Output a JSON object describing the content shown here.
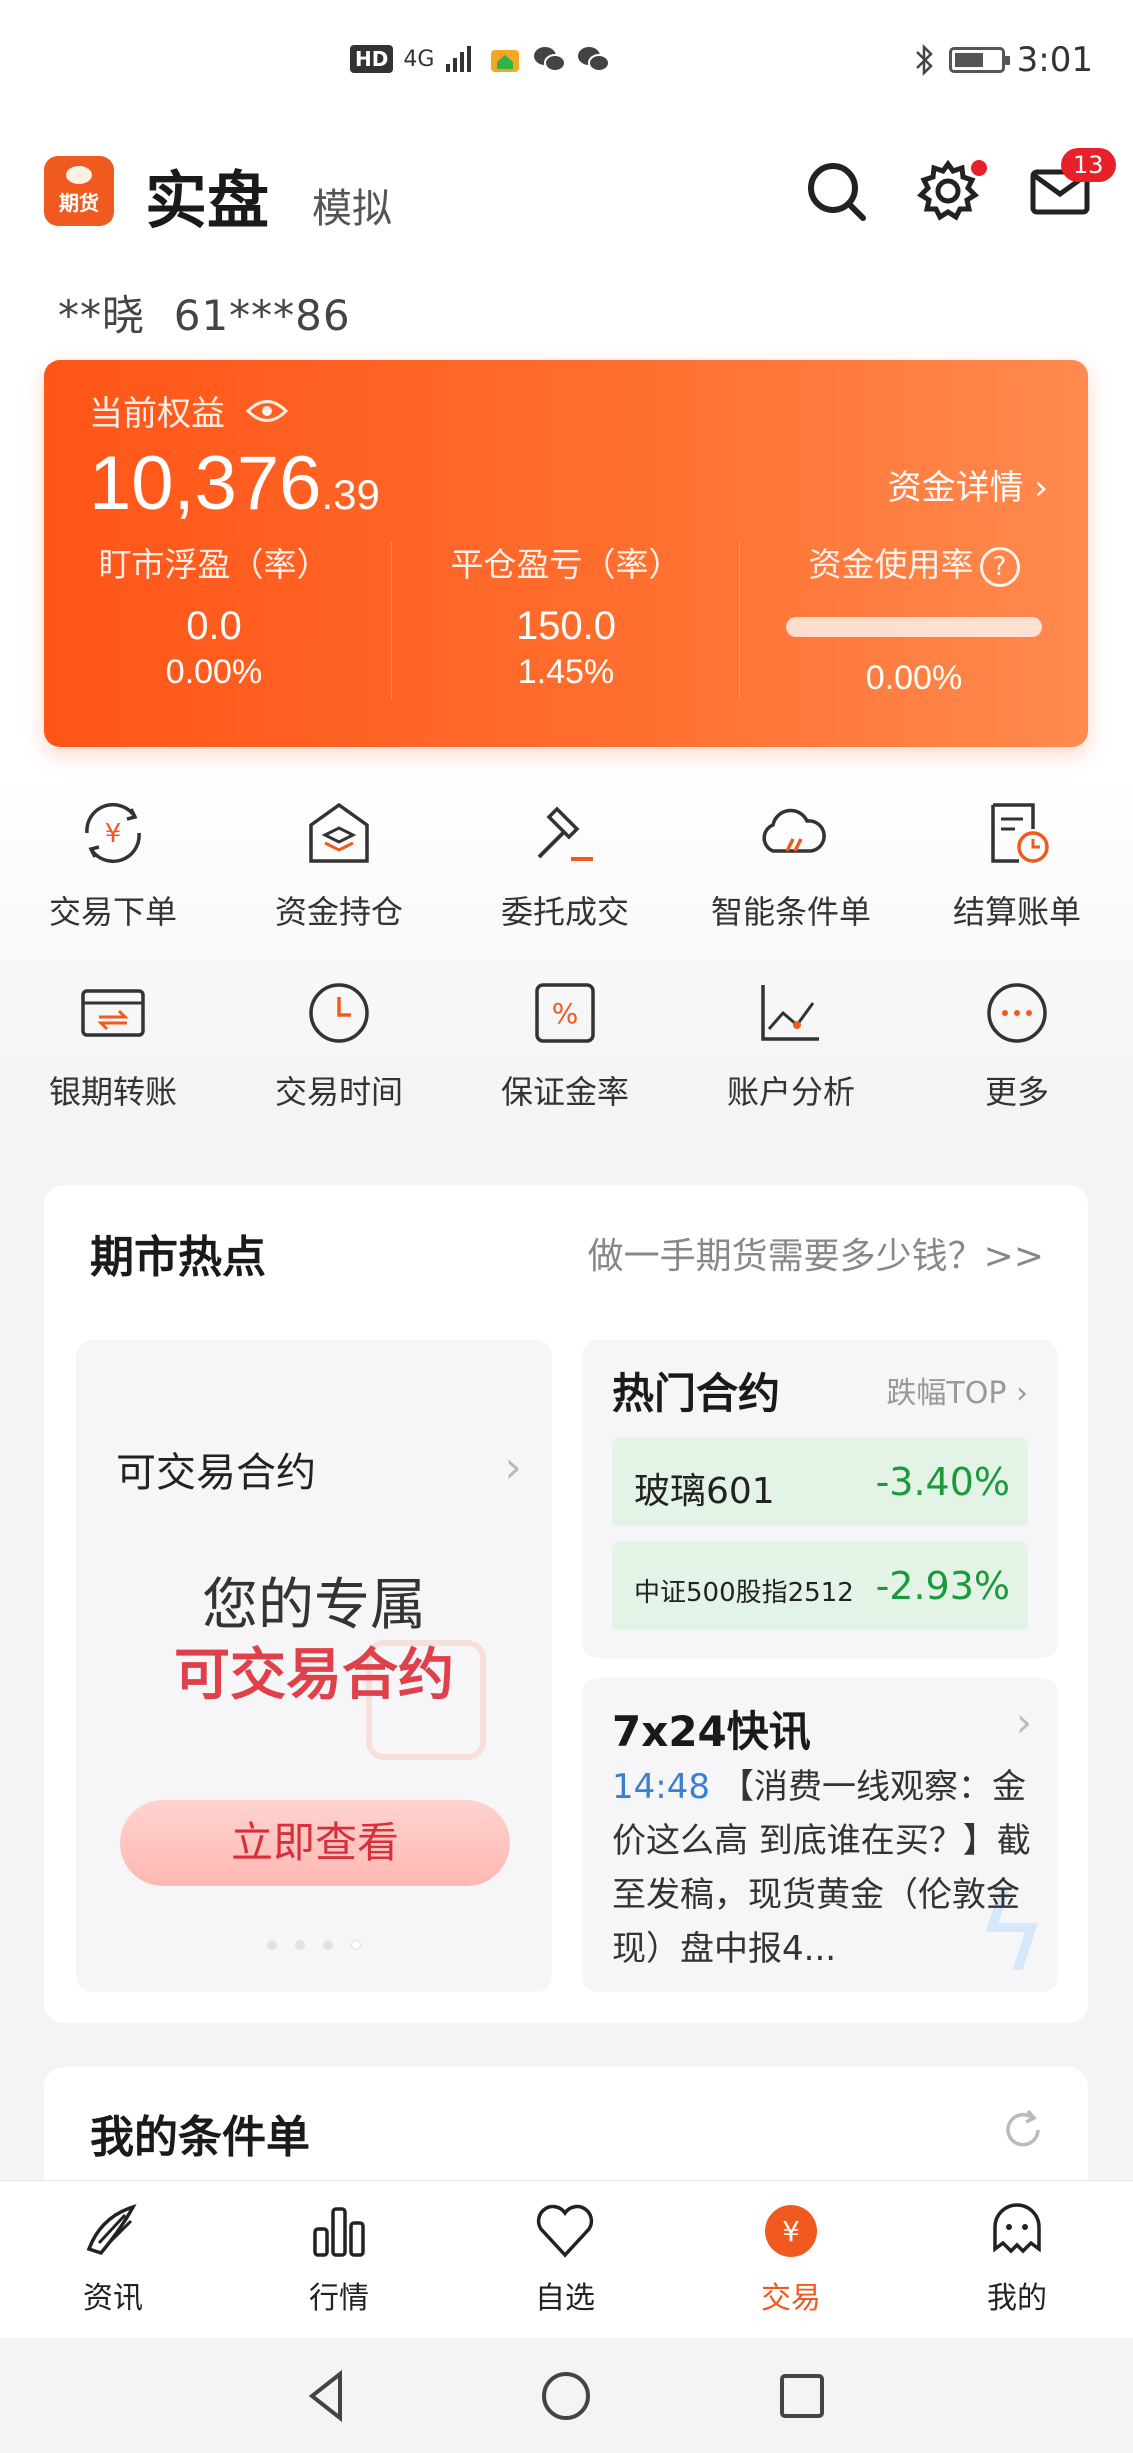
{
  "status_bar": {
    "hd": "HD",
    "signal": "4G",
    "time": "3:01"
  },
  "header": {
    "logo_text": "期货",
    "tab_active": "实盘",
    "tab_inactive": "模拟",
    "mail_badge": "13"
  },
  "account": {
    "name": "**晓",
    "number": "61***86"
  },
  "equity": {
    "label": "当前权益",
    "value_int": "10,376",
    "value_frac": ".39",
    "detail_link": "资金详情",
    "cols": [
      {
        "title": "盯市浮盈（率）",
        "v1": "0.0",
        "v2": "0.00%"
      },
      {
        "title": "平仓盈亏（率）",
        "v1": "150.0",
        "v2": "1.45%"
      },
      {
        "title": "资金使用率",
        "v2": "0.00%"
      }
    ],
    "usage_fraction": 0.0
  },
  "quick_actions": [
    {
      "label": "交易下单",
      "icon": "yuan-exchange-icon"
    },
    {
      "label": "资金持仓",
      "icon": "house-stack-icon"
    },
    {
      "label": "委托成交",
      "icon": "gavel-icon"
    },
    {
      "label": "智能条件单",
      "icon": "cloud-icon"
    },
    {
      "label": "结算账单",
      "icon": "bill-clock-icon"
    },
    {
      "label": "银期转账",
      "icon": "card-transfer-icon"
    },
    {
      "label": "交易时间",
      "icon": "clock-icon"
    },
    {
      "label": "保证金率",
      "icon": "percent-icon"
    },
    {
      "label": "账户分析",
      "icon": "line-chart-icon"
    },
    {
      "label": "更多",
      "icon": "more-icon"
    }
  ],
  "hot": {
    "title": "期市热点",
    "link": "做一手期货需要多少钱？>>",
    "left_card": {
      "title": "可交易合约",
      "big1": "您的专属",
      "big2": "可交易合约",
      "button": "立即查看"
    },
    "contracts": {
      "title": "热门合约",
      "link": "跌幅TOP",
      "rows": [
        {
          "name": "玻璃601",
          "change": "-3.40%"
        },
        {
          "name": "中证500股指2512",
          "change": "-2.93%"
        }
      ],
      "change_color": "#1a9a3a"
    },
    "news": {
      "title": "7x24快讯",
      "time": "14:48",
      "text": "【消费一线观察：金价这么高 到底谁在买？】截至发稿，现货黄金（伦敦金现）盘中报4..."
    }
  },
  "conditions": {
    "title": "我的条件单"
  },
  "bottom_nav": [
    {
      "label": "资讯",
      "icon": "news-icon"
    },
    {
      "label": "行情",
      "icon": "bar-chart-icon"
    },
    {
      "label": "自选",
      "icon": "heart-icon"
    },
    {
      "label": "交易",
      "icon": "trade-yuan-icon"
    },
    {
      "label": "我的",
      "icon": "profile-icon"
    }
  ],
  "colors": {
    "accent": "#f05a1e",
    "card_gradient_start": "#ff5518",
    "card_gradient_end": "#ff8a4f",
    "down_green": "#1a9a3a",
    "news_time_blue": "#3a7fd0"
  }
}
